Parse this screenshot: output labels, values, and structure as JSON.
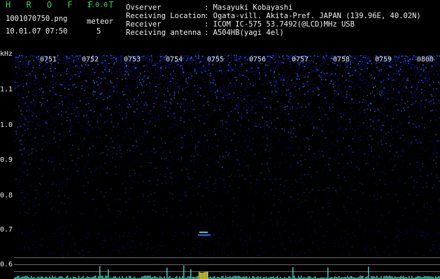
{
  "header": {
    "app_title": "H R O F F T",
    "version": "1.0.0",
    "file_name": "1001070750.png",
    "datetime": "10.01.07 07:50",
    "meteor_label": "meteor",
    "meteor_count": "5"
  },
  "station_info": [
    {
      "label": "Ovserver",
      "value": ": Masayuki Kobayashi"
    },
    {
      "label": "Receiving Location",
      "value": ": Ogata-vill. Akita-Pref. JAPAN (139.96E, 40.02N)"
    },
    {
      "label": "Receiver",
      "value": ": ICOM IC-575 53.7492(@LCD)MHz USB"
    },
    {
      "label": "Receiving antenna",
      "value": ": A504HB(yagi 4el)"
    }
  ],
  "spectrogram": {
    "y_unit": "kHz",
    "y_ticks": [
      "1.1",
      "1.0",
      "0.9",
      "0.8",
      "0.7",
      "0.6"
    ],
    "time_ticks": [
      "0751",
      "0752",
      "0753",
      "0754",
      "0755",
      "0756",
      "0757",
      "0758",
      "0759",
      "0800"
    ],
    "colors": {
      "background": "#000000",
      "noise_low": "#0a1280",
      "noise_high": "#3a6cff",
      "signal": "#ffff40",
      "trace": "#40e0d0"
    }
  }
}
